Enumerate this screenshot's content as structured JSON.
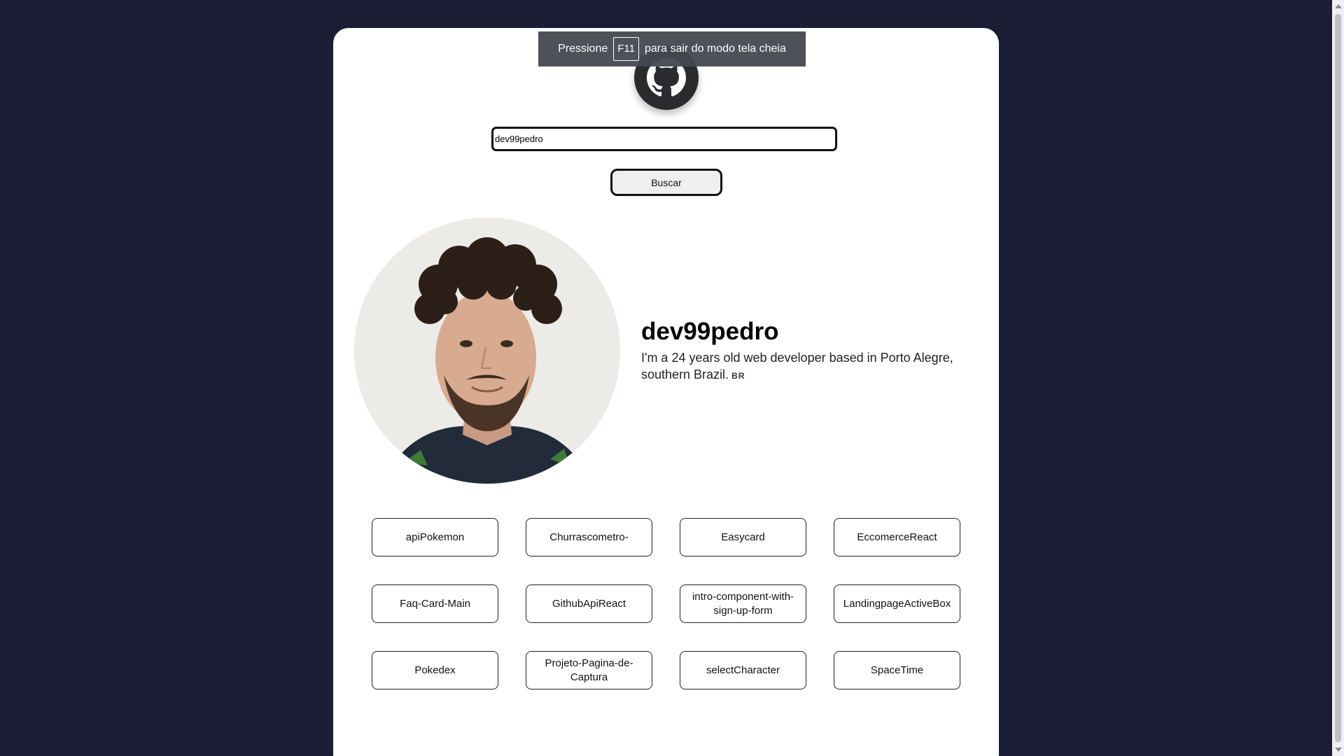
{
  "fullscreen_toast": {
    "prefix": "Pressione",
    "key": "F11",
    "suffix": "para sair do modo tela cheia"
  },
  "search": {
    "value": "dev99pedro",
    "button_label": "Buscar"
  },
  "profile": {
    "name": "dev99pedro",
    "bio": "I'm a 24 years old web developer based in Porto Alegre, southern Brazil.",
    "flag": "BR"
  },
  "repositories": [
    "apiPokemon",
    "Churrascometro-",
    "Easycard",
    "EccomerceReact",
    "Faq-Card-Main",
    "GithubApiReact",
    "intro-component-with-sign-up-form",
    "LandingpageActiveBox",
    "Pokedex",
    "Projeto-Pagina-de-Captura",
    "selectCharacter",
    "SpaceTime"
  ],
  "colors": {
    "background": "#1a1d33",
    "card": "#ffffff",
    "logo": "#2b2b2f"
  }
}
